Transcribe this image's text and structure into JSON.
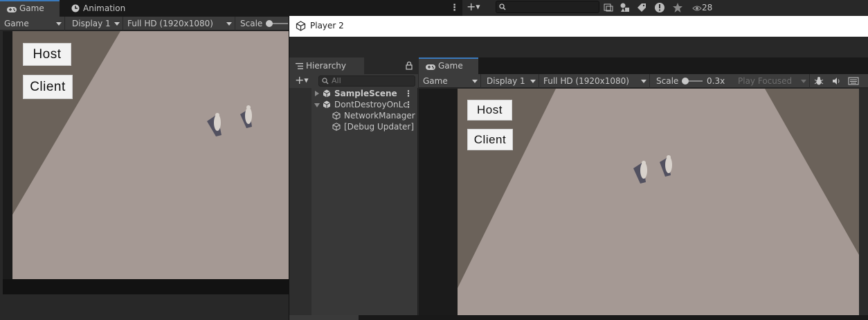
{
  "bg_editor": {
    "tabs": [
      {
        "label": "Game",
        "icon": "gamepad-icon",
        "active": true
      },
      {
        "label": "Animation",
        "icon": "clock-icon",
        "active": false
      }
    ],
    "toolbar": {
      "view_mode": "Game",
      "display": "Display 1",
      "resolution": "Full HD (1920x1080)",
      "scale_label": "Scale"
    },
    "game_buttons": {
      "host": "Host",
      "client": "Client"
    },
    "scene_tools": {
      "search_placeholder": "",
      "visible_count": "28"
    }
  },
  "player2": {
    "window_title": "Player 2",
    "hierarchy": {
      "tab_label": "Hierarchy",
      "search_placeholder": "All",
      "items": [
        {
          "label": "SampleScene",
          "depth": 0,
          "expanded": false,
          "bold": true
        },
        {
          "label": "DontDestroyOnLc",
          "depth": 0,
          "expanded": true,
          "bold": false
        },
        {
          "label": "NetworkManager",
          "depth": 1,
          "expanded": null,
          "bold": false
        },
        {
          "label": "[Debug Updater]",
          "depth": 1,
          "expanded": null,
          "bold": false
        }
      ]
    },
    "game": {
      "tab_label": "Game",
      "view_mode": "Game",
      "display": "Display 1",
      "resolution": "Full HD (1920x1080)",
      "scale_label": "Scale",
      "scale_value": "0.3x",
      "play_mode": "Play Focused",
      "game_buttons": {
        "host": "Host",
        "client": "Client"
      }
    }
  },
  "colors": {
    "editor_bg": "#282828",
    "tab_accent": "#3a79bb",
    "floor": "#a59994",
    "wall": "#6b625a"
  }
}
